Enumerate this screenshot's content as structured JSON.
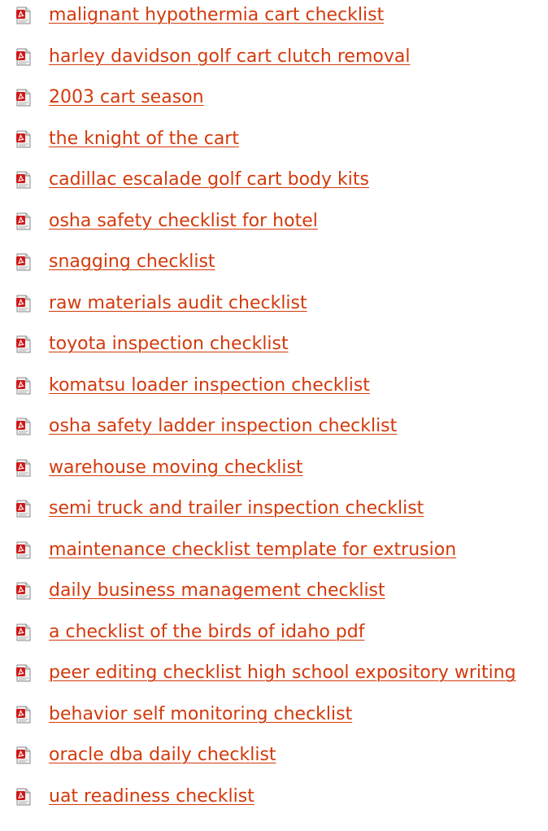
{
  "colors": {
    "link": "#d33a0c",
    "icon_page": "#e8e8e8",
    "icon_red": "#d01818"
  },
  "icon": "pdf-file-icon",
  "documents": [
    {
      "title": "malignant hypothermia cart checklist"
    },
    {
      "title": "harley davidson golf cart clutch removal"
    },
    {
      "title": "2003 cart season"
    },
    {
      "title": "the knight of the cart"
    },
    {
      "title": "cadillac escalade golf cart body kits"
    },
    {
      "title": "osha safety checklist for hotel"
    },
    {
      "title": "snagging checklist"
    },
    {
      "title": "raw materials audit checklist"
    },
    {
      "title": "toyota inspection checklist"
    },
    {
      "title": "komatsu loader inspection checklist"
    },
    {
      "title": "osha safety ladder inspection checklist"
    },
    {
      "title": "warehouse moving checklist"
    },
    {
      "title": "semi truck and trailer inspection checklist"
    },
    {
      "title": "maintenance checklist template for extrusion"
    },
    {
      "title": "daily business management checklist"
    },
    {
      "title": "a checklist of the birds of idaho pdf"
    },
    {
      "title": "peer editing checklist high school expository writing"
    },
    {
      "title": "behavior self monitoring checklist"
    },
    {
      "title": "oracle dba daily checklist"
    },
    {
      "title": "uat readiness checklist"
    }
  ]
}
